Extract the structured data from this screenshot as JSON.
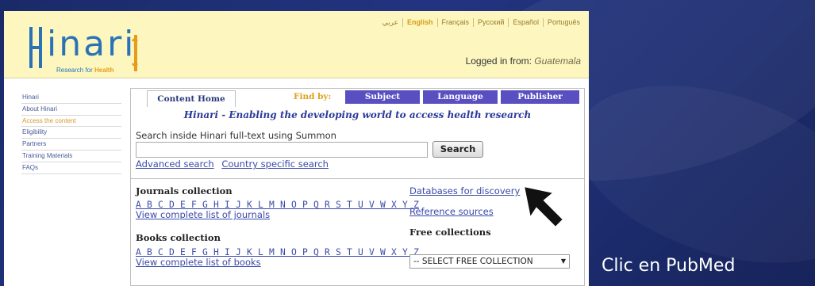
{
  "header": {
    "logo_text": "inari",
    "logo_subtitle": "Research for",
    "logo_subtitle_highlight": "Health",
    "languages": [
      {
        "label": "عربي",
        "active": false
      },
      {
        "label": "English",
        "active": true
      },
      {
        "label": "Français",
        "active": false
      },
      {
        "label": "Русский",
        "active": false
      },
      {
        "label": "Español",
        "active": false
      },
      {
        "label": "Português",
        "active": false
      }
    ],
    "logged_in_prefix": "Logged in from:",
    "logged_in_country": "Guatemala"
  },
  "sidebar": {
    "items": [
      {
        "label": "Hinari",
        "active": false
      },
      {
        "label": "About Hinari",
        "active": false
      },
      {
        "label": "Access the content",
        "active": true
      },
      {
        "label": "Eligibility",
        "active": false
      },
      {
        "label": "Partners",
        "active": false
      },
      {
        "label": "Training Materials",
        "active": false
      },
      {
        "label": "FAQs",
        "active": false
      }
    ]
  },
  "content": {
    "tab_home": "Content Home",
    "find_by": "Find by:",
    "tabs": [
      "Subject",
      "Language",
      "Publisher"
    ],
    "tagline": "Hinari - Enabling the developing world to access health research",
    "search_label": "Search inside Hinari full-text using Summon",
    "search_value": "",
    "search_button": "Search",
    "advanced_search": "Advanced search",
    "country_search": "Country specific search",
    "journals_title": "Journals collection",
    "journals_alphabet": "A B C D E F G H I J K L M N O P Q R S T U V W X Y Z",
    "journals_view_all": "View complete list of journals",
    "books_title": "Books collection",
    "books_alphabet": "A B C D E F G H I J K L M N O P Q R S T U V W X Y Z",
    "books_view_all": "View complete list of books",
    "databases_link": "Databases for discovery",
    "reference_link": "Reference sources",
    "free_collections_title": "Free collections",
    "free_collections_selected": "-- SELECT FREE COLLECTION"
  },
  "overlay": {
    "caption": "Clic en PubMed"
  },
  "colors": {
    "header_bg": "#fdf7bf",
    "tab_accent": "#5a4fc0",
    "link": "#3a4aa8",
    "logo_blue": "#2a72b8",
    "logo_orange": "#e89a1c",
    "background": "#223481"
  }
}
